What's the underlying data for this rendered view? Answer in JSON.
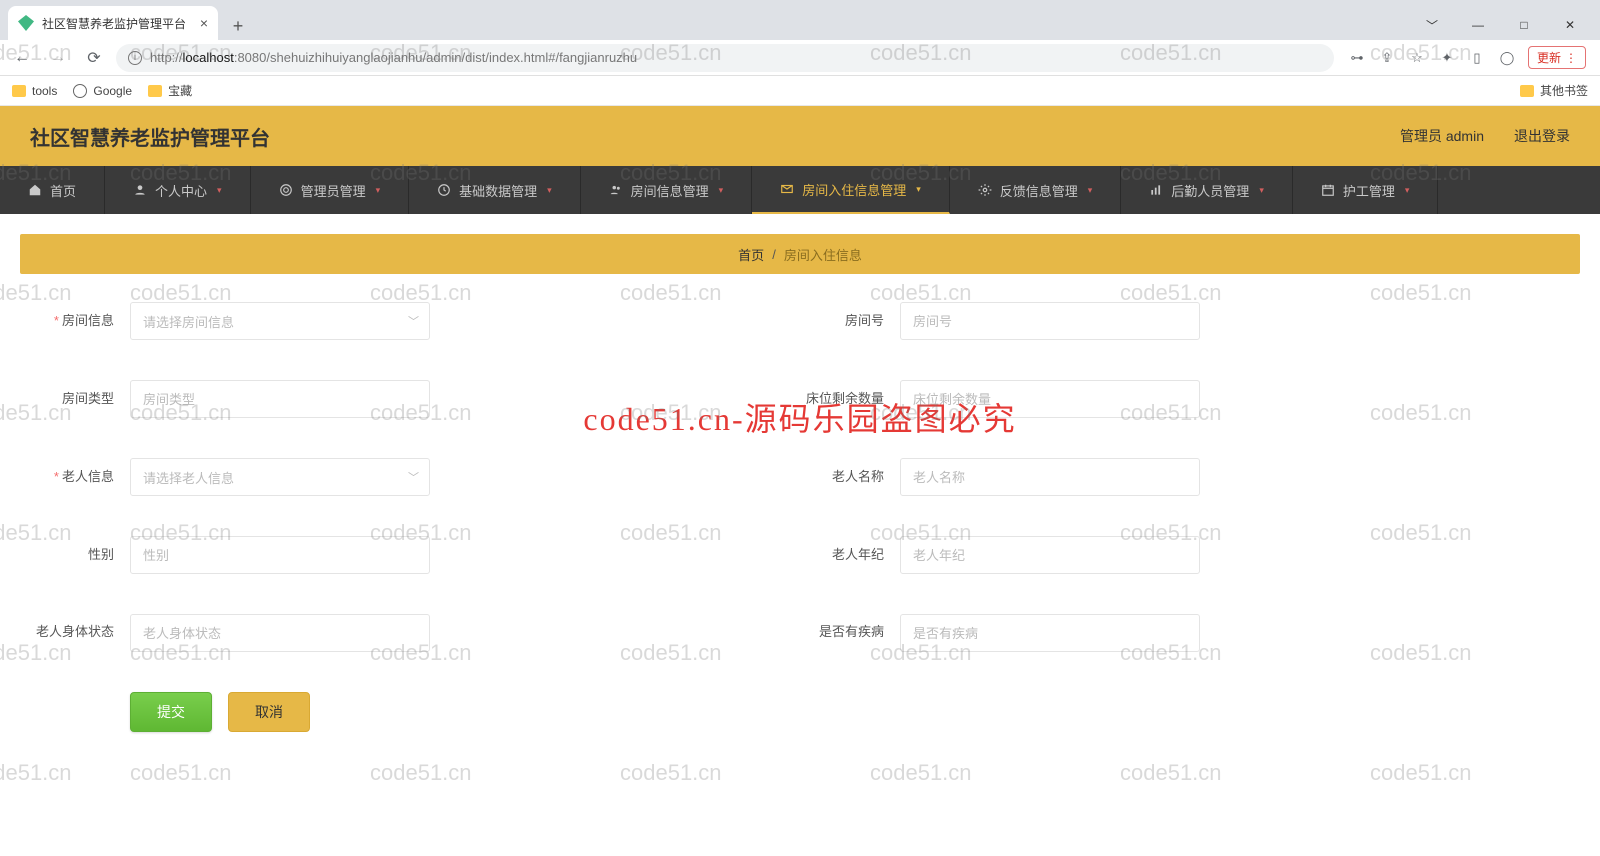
{
  "browser": {
    "tab_title": "社区智慧养老监护管理平台",
    "url_prefix": "http://",
    "url_host": "localhost",
    "url_port": ":8080",
    "url_path": "/shehuizhihuiyanglaojianhu/admin/dist/index.html#/fangjianruzhu",
    "update_label": "更新",
    "bookmarks": {
      "tools": "tools",
      "google": "Google",
      "bz": "宝藏",
      "other": "其他书签"
    }
  },
  "header": {
    "title": "社区智慧养老监护管理平台",
    "user": "管理员 admin",
    "logout": "退出登录"
  },
  "nav": [
    {
      "label": "首页",
      "drop": false
    },
    {
      "label": "个人中心",
      "drop": true
    },
    {
      "label": "管理员管理",
      "drop": true
    },
    {
      "label": "基础数据管理",
      "drop": true
    },
    {
      "label": "房间信息管理",
      "drop": true
    },
    {
      "label": "房间入住信息管理",
      "drop": true,
      "active": true
    },
    {
      "label": "反馈信息管理",
      "drop": true
    },
    {
      "label": "后勤人员管理",
      "drop": true
    },
    {
      "label": "护工管理",
      "drop": true
    }
  ],
  "breadcrumb": {
    "home": "首页",
    "current": "房间入住信息"
  },
  "form": {
    "room_info_label": "房间信息",
    "room_info_placeholder": "请选择房间信息",
    "room_no_label": "房间号",
    "room_no_placeholder": "房间号",
    "room_type_label": "房间类型",
    "room_type_placeholder": "房间类型",
    "bed_left_label": "床位剩余数量",
    "bed_left_label_short": "床位剩余数量",
    "bed_left_placeholder": "床位剩余数量",
    "elder_info_label": "老人信息",
    "elder_info_placeholder": "请选择老人信息",
    "elder_name_label": "老人名称",
    "elder_name_placeholder": "老人名称",
    "gender_label": "性别",
    "gender_placeholder": "性别",
    "elder_age_label": "老人年纪",
    "elder_age_placeholder": "老人年纪",
    "elder_body_label": "老人身体状态",
    "elder_body_placeholder": "老人身体状态",
    "has_disease_label": "是否有疾病",
    "has_disease_placeholder": "是否有疾病",
    "submit": "提交",
    "cancel": "取消"
  },
  "watermark": {
    "text": "code51.cn",
    "red": "code51.cn-源码乐园盗图必究"
  }
}
